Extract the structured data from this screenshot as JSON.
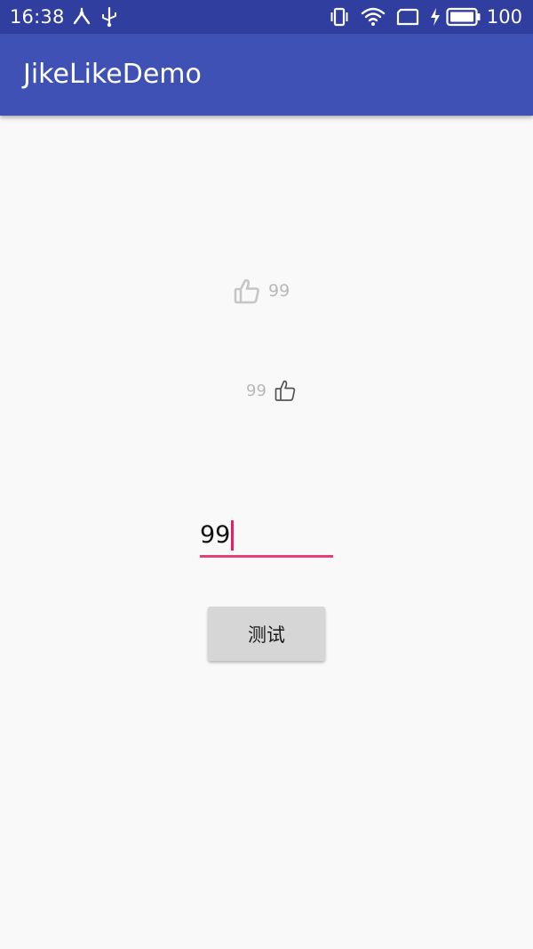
{
  "status_bar": {
    "time": "16:38",
    "battery_percent": "100",
    "left_icons": [
      "sync-icon",
      "usb-icon"
    ],
    "right_icons": [
      "vibrate-icon",
      "wifi-icon",
      "screen-icon",
      "charging-icon",
      "battery-icon"
    ]
  },
  "app_bar": {
    "title": "JikeLikeDemo",
    "color": "#3f51b5",
    "status_color": "#303f9f"
  },
  "like_widgets": [
    {
      "count": "99",
      "icon": "thumbs-up-icon",
      "icon_position": "left"
    },
    {
      "count": "99",
      "icon": "thumbs-up-icon",
      "icon_position": "right"
    }
  ],
  "count_input": {
    "value": "99",
    "accent_color": "#e91e63"
  },
  "test_button": {
    "label": "测试"
  }
}
